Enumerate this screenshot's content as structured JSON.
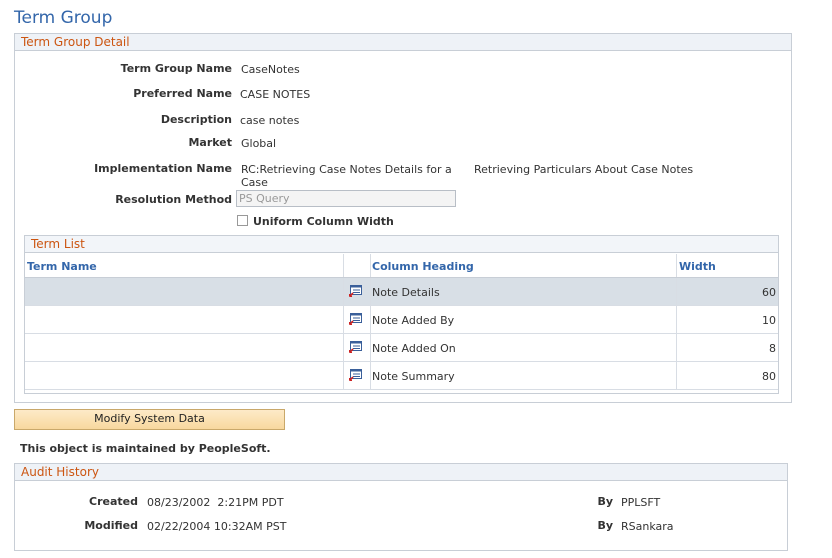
{
  "page": {
    "title": "Term Group"
  },
  "detail": {
    "section_title": "Term Group Detail",
    "term_group_name_label": "Term Group Name",
    "term_group_name": "CaseNotes",
    "preferred_name_label": "Preferred Name",
    "preferred_name": "CASE NOTES",
    "description_label": "Description",
    "description": "case notes",
    "market_label": "Market",
    "market": "Global",
    "implementation_name_label": "Implementation Name",
    "implementation_name_line1": "RC:Retrieving Case Notes Details for a",
    "implementation_name_line2": "Case",
    "implementation_description": "Retrieving Particulars About Case Notes",
    "resolution_method_label": "Resolution Method",
    "resolution_method_value": "PS Query",
    "uniform_column_width_label": "Uniform Column Width"
  },
  "term_list": {
    "title": "Term List",
    "headers": {
      "term_name": "Term Name",
      "column_heading": "Column Heading",
      "width": "Width"
    },
    "rows": [
      {
        "term_name": "",
        "column_heading": "Note Details",
        "width": "60"
      },
      {
        "term_name": "",
        "column_heading": "Note Added By",
        "width": "10"
      },
      {
        "term_name": "",
        "column_heading": "Note Added On",
        "width": "8"
      },
      {
        "term_name": "",
        "column_heading": "Note Summary",
        "width": "80"
      }
    ]
  },
  "actions": {
    "modify_label": "Modify System Data"
  },
  "notice": "This object is maintained by PeopleSoft.",
  "audit": {
    "title": "Audit History",
    "created_label": "Created",
    "created_value": "08/23/2002  2:21PM PDT",
    "created_by_label": "By",
    "created_by": "PPLSFT",
    "modified_label": "Modified",
    "modified_value": "02/22/2004 10:32AM PST",
    "modified_by_label": "By",
    "modified_by": "RSankara"
  },
  "colors": {
    "title_blue": "#3366aa",
    "section_orange": "#cc5511",
    "selected_row": "#d8dfe6"
  },
  "icons": {
    "row_action": "prompt-lookup-icon"
  }
}
